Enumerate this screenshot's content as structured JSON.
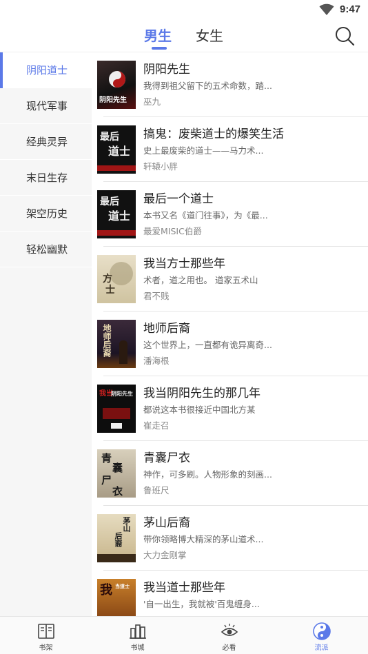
{
  "status": {
    "time": "9:47"
  },
  "tabs": {
    "male": "男生",
    "female": "女生"
  },
  "sidebar": {
    "items": [
      {
        "label": "阴阳道士"
      },
      {
        "label": "现代军事"
      },
      {
        "label": "经典灵异"
      },
      {
        "label": "末日生存"
      },
      {
        "label": "架空历史"
      },
      {
        "label": "轻松幽默"
      }
    ]
  },
  "books": [
    {
      "title": "阴阳先生",
      "desc": "我得到祖父留下的五术命数，踏...",
      "author": "巫九"
    },
    {
      "title": "搞鬼：废柴道士的爆笑生活",
      "desc": "史上最废柴的道士——马力术...",
      "author": "轩辕小胖"
    },
    {
      "title": "最后一个道士",
      "desc": "本书又名《道门往事》，为《最...",
      "author": "最爱MISIC伯爵"
    },
    {
      "title": "我当方士那些年",
      "desc": "术者，道之用也。 道家五术山",
      "author": "君不贱"
    },
    {
      "title": "地师后裔",
      "desc": "这个世界上，一直都有诡异离奇...",
      "author": "潘海根"
    },
    {
      "title": "我当阴阳先生的那几年",
      "desc": "都说这本书很接近中国北方某",
      "author": "崔走召"
    },
    {
      "title": "青囊尸衣",
      "desc": "神作，可多刷。人物形象的刻画...",
      "author": "鲁班尺"
    },
    {
      "title": "茅山后裔",
      "desc": "带你领略博大精深的茅山道术...",
      "author": "大力金刚掌"
    },
    {
      "title": "我当道士那些年",
      "desc": "'自一出生，我就被'百鬼缠身...",
      "author": ""
    }
  ],
  "cover_art": {
    "c1": "阴阳先生",
    "c2a": "最后",
    "c2b": "道士",
    "c3a": "最后",
    "c3b": "道士",
    "c4a": "方",
    "c4b": "士",
    "c5": "地师后裔",
    "c6a": "我当",
    "c6b": "阴阳先生",
    "c7a": "青",
    "c7b": "囊",
    "c7c": "尸",
    "c7d": "衣",
    "c8a": "茅山",
    "c8b": "后裔",
    "c9a": "我",
    "c9b": "当道士"
  },
  "bottom_nav": [
    {
      "label": "书架",
      "icon": "book-icon"
    },
    {
      "label": "书城",
      "icon": "bookstore-icon"
    },
    {
      "label": "必看",
      "icon": "eye-icon"
    },
    {
      "label": "流派",
      "icon": "yinyang-icon"
    }
  ],
  "colors": {
    "accent": "#5b79e8"
  }
}
